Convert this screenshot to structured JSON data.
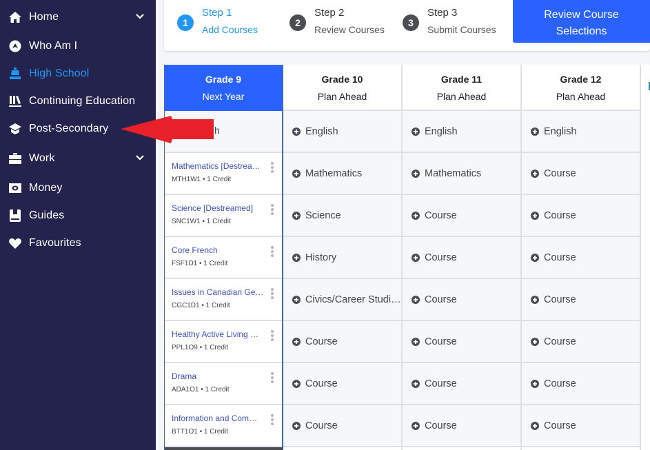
{
  "sidebar": {
    "items": [
      {
        "label": "Home",
        "icon": "home-icon",
        "has_chevron": true,
        "active": false
      },
      {
        "label": "Who Am I",
        "icon": "compass-icon",
        "has_chevron": false,
        "active": false
      },
      {
        "label": "High School",
        "icon": "school-bell-icon",
        "has_chevron": false,
        "active": true
      },
      {
        "label": "Continuing Education",
        "icon": "books-icon",
        "has_chevron": false,
        "active": false
      },
      {
        "label": "Post-Secondary",
        "icon": "graduation-cap-icon",
        "has_chevron": false,
        "active": false
      },
      {
        "label": "Work",
        "icon": "briefcase-icon",
        "has_chevron": true,
        "active": false
      },
      {
        "label": "Money",
        "icon": "money-icon",
        "has_chevron": false,
        "active": false
      },
      {
        "label": "Guides",
        "icon": "book-icon",
        "has_chevron": false,
        "active": false
      },
      {
        "label": "Favourites",
        "icon": "heart-icon",
        "has_chevron": false,
        "active": false
      }
    ]
  },
  "steps": [
    {
      "number": "1",
      "title": "Step 1",
      "subtitle": "Add Courses",
      "active": true
    },
    {
      "number": "2",
      "title": "Step 2",
      "subtitle": "Review Courses",
      "active": false
    },
    {
      "number": "3",
      "title": "Step 3",
      "subtitle": "Submit Courses",
      "active": false
    }
  ],
  "review_button": {
    "line1": "Review Course",
    "line2": "Selections"
  },
  "colors": {
    "sidebar_bg": "#23234d",
    "active_blue": "#2196f3",
    "primary_button": "#2962ff",
    "annotation_red": "#e8202a"
  },
  "grades": [
    {
      "grade": "Grade 9",
      "subtitle": "Next Year",
      "current": true,
      "first_cell_partial": "h",
      "courses": [
        {
          "name": "Mathematics [Destreamed]",
          "code": "MTH1W1",
          "credit": "1 Credit"
        },
        {
          "name": "Science [Destreamed]",
          "code": "SNC1W1",
          "credit": "1 Credit"
        },
        {
          "name": "Core French",
          "code": "FSF1D1",
          "credit": "1 Credit"
        },
        {
          "name": "Issues in Canadian Geography",
          "code": "CGC1D1",
          "credit": "1 Credit"
        },
        {
          "name": "Healthy Active Living Education",
          "code": "PPL1O9",
          "credit": "1 Credit"
        },
        {
          "name": "Drama",
          "code": "ADA1O1",
          "credit": "1 Credit"
        },
        {
          "name": "Information and Communication Technology",
          "code": "BTT1O1",
          "credit": "1 Credit"
        }
      ]
    },
    {
      "grade": "Grade 10",
      "subtitle": "Plan Ahead",
      "current": false,
      "slots": [
        "English",
        "Mathematics",
        "Science",
        "History",
        "Civics/Career Studies",
        "Course",
        "Course",
        "Course"
      ]
    },
    {
      "grade": "Grade 11",
      "subtitle": "Plan Ahead",
      "current": false,
      "slots": [
        "English",
        "Mathematics",
        "Course",
        "Course",
        "Course",
        "Course",
        "Course",
        "Course"
      ]
    },
    {
      "grade": "Grade 12",
      "subtitle": "Plan Ahead",
      "current": false,
      "slots": [
        "English",
        "Course",
        "Course",
        "Course",
        "Course",
        "Course",
        "Course",
        "Course"
      ]
    }
  ]
}
